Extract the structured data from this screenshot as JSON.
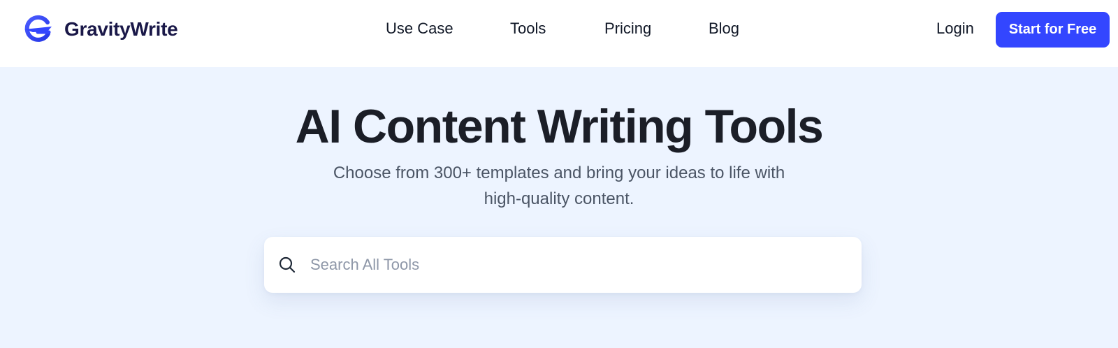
{
  "header": {
    "logo_text": "GravityWrite",
    "logo_icon": "gravitywrite-logo-icon",
    "nav": [
      {
        "label": "Use Case"
      },
      {
        "label": "Tools"
      },
      {
        "label": "Pricing"
      },
      {
        "label": "Blog"
      }
    ],
    "login_label": "Login",
    "cta_label": "Start for Free"
  },
  "hero": {
    "title": "AI Content Writing Tools",
    "subtitle": "Choose from 300+ templates and bring your ideas to life with high-quality content."
  },
  "search": {
    "icon": "search-icon",
    "placeholder": "Search All Tools",
    "value": ""
  },
  "colors": {
    "brand": "#3346ff",
    "hero_background": "#edf4ff",
    "logo_text": "#1a1848"
  }
}
